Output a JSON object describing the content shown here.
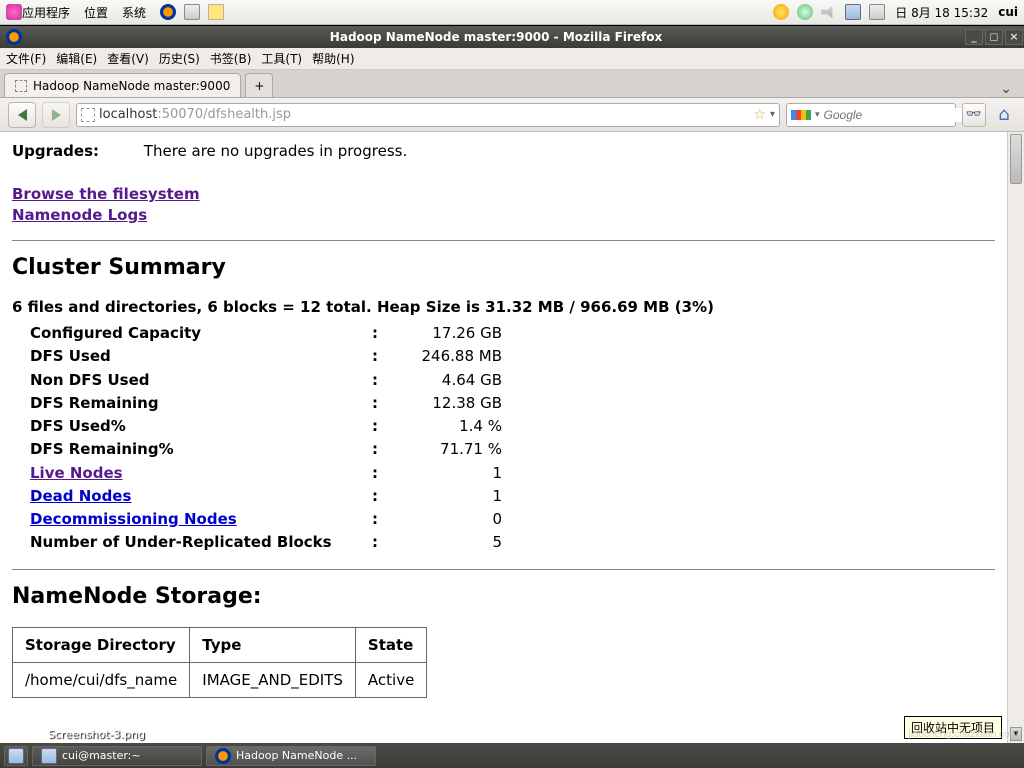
{
  "gnome_panel": {
    "menus": [
      "应用程序",
      "位置",
      "系统"
    ],
    "clock": "日 8月 18 15:32",
    "user": "cui"
  },
  "firefox": {
    "title": "Hadoop NameNode master:9000 - Mozilla Firefox",
    "menubar": [
      "文件(F)",
      "编辑(E)",
      "查看(V)",
      "历史(S)",
      "书签(B)",
      "工具(T)",
      "帮助(H)"
    ],
    "tab_label": "Hadoop NameNode master:9000",
    "url_host": "localhost",
    "url_path": ":50070/dfshealth.jsp",
    "search_placeholder": "Google"
  },
  "page": {
    "upgrades_label": "Upgrades:",
    "upgrades_text": "There are no upgrades in progress.",
    "link_browse": "Browse the filesystem",
    "link_logs": "Namenode Logs",
    "h_cluster": "Cluster Summary",
    "summary_line": "6 files and directories, 6 blocks = 12 total. Heap Size is 31.32 MB / 966.69 MB (3%)",
    "stats": [
      {
        "label": "Configured Capacity",
        "value": "17.26 GB",
        "link": false
      },
      {
        "label": "DFS Used",
        "value": "246.88 MB",
        "link": false
      },
      {
        "label": "Non DFS Used",
        "value": "4.64 GB",
        "link": false
      },
      {
        "label": "DFS Remaining",
        "value": "12.38 GB",
        "link": false
      },
      {
        "label": "DFS Used%",
        "value": "1.4 %",
        "link": false
      },
      {
        "label": "DFS Remaining%",
        "value": "71.71 %",
        "link": false
      },
      {
        "label": "Live Nodes",
        "value": "1",
        "link": true,
        "blue": false
      },
      {
        "label": "Dead Nodes",
        "value": "1",
        "link": true,
        "blue": true
      },
      {
        "label": "Decommissioning Nodes",
        "value": "0",
        "link": true,
        "blue": true
      },
      {
        "label": "Number of Under-Replicated Blocks",
        "value": "5",
        "link": false
      }
    ],
    "h_storage": "NameNode Storage:",
    "storage_headers": [
      "Storage Directory",
      "Type",
      "State"
    ],
    "storage_row": [
      "/home/cui/dfs_name",
      "IMAGE_AND_EDITS",
      "Active"
    ]
  },
  "tooltip": "回收站中无项目",
  "taskbar": {
    "file_on_desktop": "Screenshot-3.png",
    "items": [
      "cui@master:~",
      "Hadoop NameNode ..."
    ]
  },
  "watermark": "jiaocheng.chazidian.com"
}
